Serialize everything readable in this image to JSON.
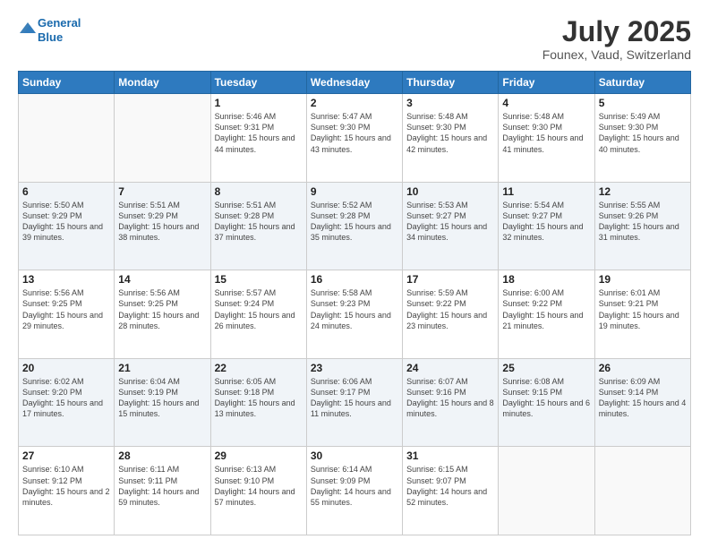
{
  "header": {
    "logo_line1": "General",
    "logo_line2": "Blue",
    "title": "July 2025",
    "subtitle": "Founex, Vaud, Switzerland"
  },
  "days_of_week": [
    "Sunday",
    "Monday",
    "Tuesday",
    "Wednesday",
    "Thursday",
    "Friday",
    "Saturday"
  ],
  "weeks": [
    [
      {
        "day": "",
        "sunrise": "",
        "sunset": "",
        "daylight": ""
      },
      {
        "day": "",
        "sunrise": "",
        "sunset": "",
        "daylight": ""
      },
      {
        "day": "1",
        "sunrise": "Sunrise: 5:46 AM",
        "sunset": "Sunset: 9:31 PM",
        "daylight": "Daylight: 15 hours and 44 minutes."
      },
      {
        "day": "2",
        "sunrise": "Sunrise: 5:47 AM",
        "sunset": "Sunset: 9:30 PM",
        "daylight": "Daylight: 15 hours and 43 minutes."
      },
      {
        "day": "3",
        "sunrise": "Sunrise: 5:48 AM",
        "sunset": "Sunset: 9:30 PM",
        "daylight": "Daylight: 15 hours and 42 minutes."
      },
      {
        "day": "4",
        "sunrise": "Sunrise: 5:48 AM",
        "sunset": "Sunset: 9:30 PM",
        "daylight": "Daylight: 15 hours and 41 minutes."
      },
      {
        "day": "5",
        "sunrise": "Sunrise: 5:49 AM",
        "sunset": "Sunset: 9:30 PM",
        "daylight": "Daylight: 15 hours and 40 minutes."
      }
    ],
    [
      {
        "day": "6",
        "sunrise": "Sunrise: 5:50 AM",
        "sunset": "Sunset: 9:29 PM",
        "daylight": "Daylight: 15 hours and 39 minutes."
      },
      {
        "day": "7",
        "sunrise": "Sunrise: 5:51 AM",
        "sunset": "Sunset: 9:29 PM",
        "daylight": "Daylight: 15 hours and 38 minutes."
      },
      {
        "day": "8",
        "sunrise": "Sunrise: 5:51 AM",
        "sunset": "Sunset: 9:28 PM",
        "daylight": "Daylight: 15 hours and 37 minutes."
      },
      {
        "day": "9",
        "sunrise": "Sunrise: 5:52 AM",
        "sunset": "Sunset: 9:28 PM",
        "daylight": "Daylight: 15 hours and 35 minutes."
      },
      {
        "day": "10",
        "sunrise": "Sunrise: 5:53 AM",
        "sunset": "Sunset: 9:27 PM",
        "daylight": "Daylight: 15 hours and 34 minutes."
      },
      {
        "day": "11",
        "sunrise": "Sunrise: 5:54 AM",
        "sunset": "Sunset: 9:27 PM",
        "daylight": "Daylight: 15 hours and 32 minutes."
      },
      {
        "day": "12",
        "sunrise": "Sunrise: 5:55 AM",
        "sunset": "Sunset: 9:26 PM",
        "daylight": "Daylight: 15 hours and 31 minutes."
      }
    ],
    [
      {
        "day": "13",
        "sunrise": "Sunrise: 5:56 AM",
        "sunset": "Sunset: 9:25 PM",
        "daylight": "Daylight: 15 hours and 29 minutes."
      },
      {
        "day": "14",
        "sunrise": "Sunrise: 5:56 AM",
        "sunset": "Sunset: 9:25 PM",
        "daylight": "Daylight: 15 hours and 28 minutes."
      },
      {
        "day": "15",
        "sunrise": "Sunrise: 5:57 AM",
        "sunset": "Sunset: 9:24 PM",
        "daylight": "Daylight: 15 hours and 26 minutes."
      },
      {
        "day": "16",
        "sunrise": "Sunrise: 5:58 AM",
        "sunset": "Sunset: 9:23 PM",
        "daylight": "Daylight: 15 hours and 24 minutes."
      },
      {
        "day": "17",
        "sunrise": "Sunrise: 5:59 AM",
        "sunset": "Sunset: 9:22 PM",
        "daylight": "Daylight: 15 hours and 23 minutes."
      },
      {
        "day": "18",
        "sunrise": "Sunrise: 6:00 AM",
        "sunset": "Sunset: 9:22 PM",
        "daylight": "Daylight: 15 hours and 21 minutes."
      },
      {
        "day": "19",
        "sunrise": "Sunrise: 6:01 AM",
        "sunset": "Sunset: 9:21 PM",
        "daylight": "Daylight: 15 hours and 19 minutes."
      }
    ],
    [
      {
        "day": "20",
        "sunrise": "Sunrise: 6:02 AM",
        "sunset": "Sunset: 9:20 PM",
        "daylight": "Daylight: 15 hours and 17 minutes."
      },
      {
        "day": "21",
        "sunrise": "Sunrise: 6:04 AM",
        "sunset": "Sunset: 9:19 PM",
        "daylight": "Daylight: 15 hours and 15 minutes."
      },
      {
        "day": "22",
        "sunrise": "Sunrise: 6:05 AM",
        "sunset": "Sunset: 9:18 PM",
        "daylight": "Daylight: 15 hours and 13 minutes."
      },
      {
        "day": "23",
        "sunrise": "Sunrise: 6:06 AM",
        "sunset": "Sunset: 9:17 PM",
        "daylight": "Daylight: 15 hours and 11 minutes."
      },
      {
        "day": "24",
        "sunrise": "Sunrise: 6:07 AM",
        "sunset": "Sunset: 9:16 PM",
        "daylight": "Daylight: 15 hours and 8 minutes."
      },
      {
        "day": "25",
        "sunrise": "Sunrise: 6:08 AM",
        "sunset": "Sunset: 9:15 PM",
        "daylight": "Daylight: 15 hours and 6 minutes."
      },
      {
        "day": "26",
        "sunrise": "Sunrise: 6:09 AM",
        "sunset": "Sunset: 9:14 PM",
        "daylight": "Daylight: 15 hours and 4 minutes."
      }
    ],
    [
      {
        "day": "27",
        "sunrise": "Sunrise: 6:10 AM",
        "sunset": "Sunset: 9:12 PM",
        "daylight": "Daylight: 15 hours and 2 minutes."
      },
      {
        "day": "28",
        "sunrise": "Sunrise: 6:11 AM",
        "sunset": "Sunset: 9:11 PM",
        "daylight": "Daylight: 14 hours and 59 minutes."
      },
      {
        "day": "29",
        "sunrise": "Sunrise: 6:13 AM",
        "sunset": "Sunset: 9:10 PM",
        "daylight": "Daylight: 14 hours and 57 minutes."
      },
      {
        "day": "30",
        "sunrise": "Sunrise: 6:14 AM",
        "sunset": "Sunset: 9:09 PM",
        "daylight": "Daylight: 14 hours and 55 minutes."
      },
      {
        "day": "31",
        "sunrise": "Sunrise: 6:15 AM",
        "sunset": "Sunset: 9:07 PM",
        "daylight": "Daylight: 14 hours and 52 minutes."
      },
      {
        "day": "",
        "sunrise": "",
        "sunset": "",
        "daylight": ""
      },
      {
        "day": "",
        "sunrise": "",
        "sunset": "",
        "daylight": ""
      }
    ]
  ]
}
